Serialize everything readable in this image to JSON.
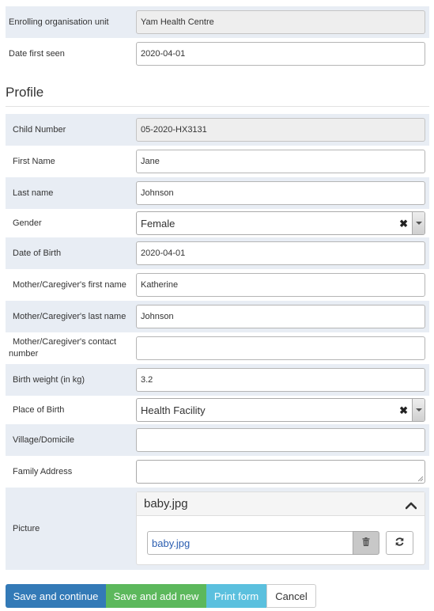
{
  "enrollment": {
    "org_unit_label": "Enrolling organisation unit",
    "org_unit_value": "Yam Health Centre",
    "date_first_seen_label": "Date first seen",
    "date_first_seen_value": "2020-04-01"
  },
  "profile": {
    "title": "Profile",
    "child_number_label": "Child Number",
    "child_number_value": "05-2020-HX3131",
    "first_name_label": "First Name",
    "first_name_value": "Jane",
    "last_name_label": "Last name",
    "last_name_value": "Johnson",
    "gender_label": "Gender",
    "gender_value": "Female",
    "dob_label": "Date of Birth",
    "dob_value": "2020-04-01",
    "mother_first_label": "Mother/Caregiver's first name",
    "mother_first_value": "Katherine",
    "mother_last_label": "Mother/Caregiver's last name",
    "mother_last_value": "Johnson",
    "mother_contact_label": "Mother/Caregiver's contact number",
    "mother_contact_value": "",
    "birth_weight_label": "Birth weight (in kg)",
    "birth_weight_value": "3.2",
    "place_of_birth_label": "Place of Birth",
    "place_of_birth_value": "Health Facility",
    "village_label": "Village/Domicile",
    "village_value": "",
    "family_address_label": "Family Address",
    "family_address_value": "",
    "picture_label": "Picture",
    "picture_panel_title": "baby.jpg",
    "picture_file_name": "baby.jpg"
  },
  "actions": {
    "save_continue": "Save and continue",
    "save_add_new": "Save and add new",
    "print_form": "Print form",
    "cancel": "Cancel"
  },
  "icons": {
    "clear": "close-icon",
    "dropdown": "chevron-down-icon",
    "collapse": "chevron-up-icon",
    "delete": "trash-icon",
    "replace": "refresh-icon"
  },
  "colors": {
    "primary": "#337ab7",
    "success": "#5cb85c",
    "info": "#5bc0de",
    "row_shade": "#e8edf4"
  }
}
